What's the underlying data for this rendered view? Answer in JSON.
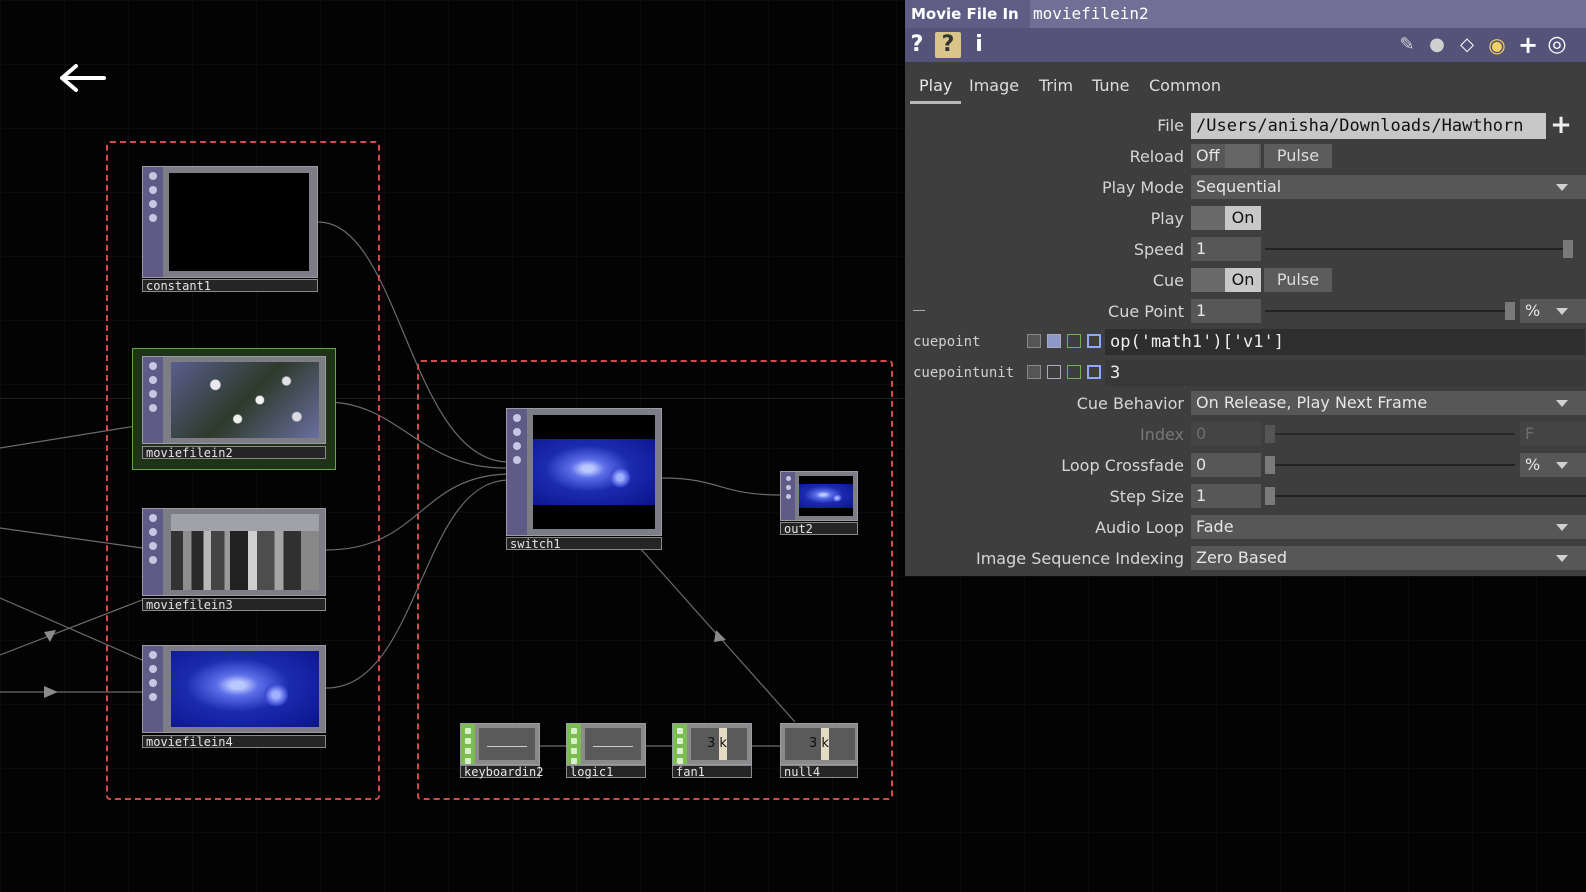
{
  "network": {
    "nodes": {
      "constant1": "constant1",
      "moviefilein2": "moviefilein2",
      "moviefilein3": "moviefilein3",
      "moviefilein4": "moviefilein4",
      "switch1": "switch1",
      "out2": "out2",
      "keyboardin2": "keyboardin2",
      "logic1": "logic1",
      "fan1": "fan1",
      "null4": "null4"
    },
    "chop_values": {
      "fan1": "3 k",
      "null4": "3 k"
    }
  },
  "panel": {
    "op_type": "Movie File In",
    "op_name": "moviefilein2",
    "tabs": [
      "Play",
      "Image",
      "Trim",
      "Tune",
      "Common"
    ],
    "active_tab": "Play",
    "params": {
      "file_label": "File",
      "file_value": "/Users/anisha/Downloads/Hawthorn",
      "reload_label": "Reload",
      "reload_value": "Off",
      "reload_pulse": "Pulse",
      "play_mode_label": "Play Mode",
      "play_mode_value": "Sequential",
      "play_label": "Play",
      "play_value": "On",
      "speed_label": "Speed",
      "speed_value": "1",
      "cue_label": "Cue",
      "cue_value": "On",
      "cue_pulse": "Pulse",
      "cue_point_label": "Cue Point",
      "cue_point_value": "1",
      "cue_point_unit": "%",
      "cuepoint_expr_label": "cuepoint",
      "cuepoint_expr": "op('math1')['v1']",
      "cuepointunit_expr_label": "cuepointunit",
      "cuepointunit_expr": "3",
      "cue_behavior_label": "Cue Behavior",
      "cue_behavior_value": "On Release, Play Next Frame",
      "index_label": "Index",
      "index_value": "0",
      "index_unit": "F",
      "loop_crossfade_label": "Loop Crossfade",
      "loop_crossfade_value": "0",
      "loop_crossfade_unit": "%",
      "step_size_label": "Step Size",
      "step_size_value": "1",
      "audio_loop_label": "Audio Loop",
      "audio_loop_value": "Fade",
      "image_seq_label": "Image Sequence Indexing",
      "image_seq_value": "Zero Based"
    }
  },
  "colors": {
    "dashed_box": "#d5494a",
    "panel_title": "#5f5d86",
    "selected_node_border": "#5fa94a"
  }
}
